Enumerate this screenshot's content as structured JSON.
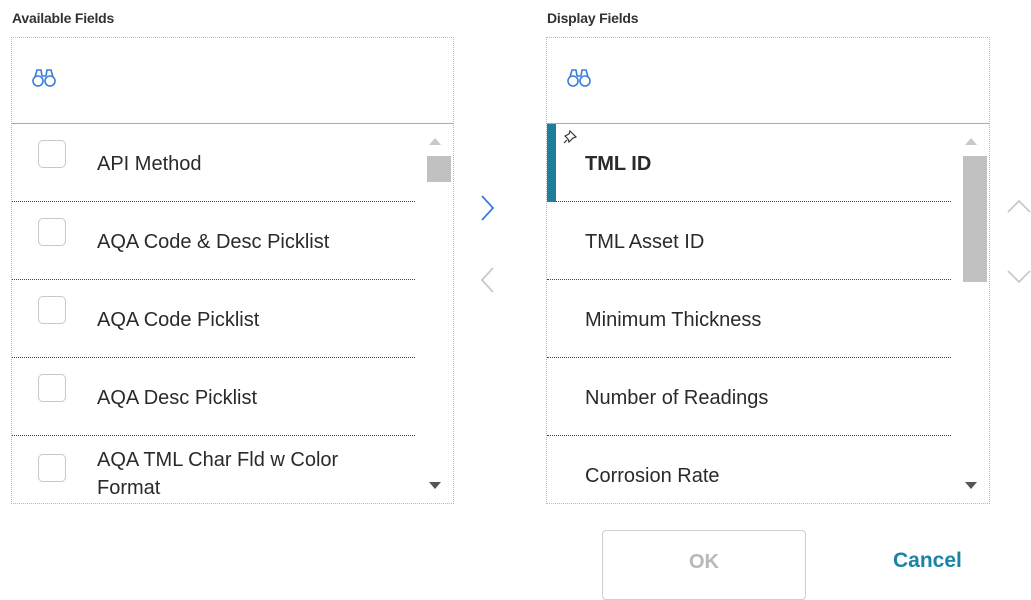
{
  "available": {
    "title": "Available Fields",
    "items": [
      {
        "label": "API Method"
      },
      {
        "label": "AQA Code & Desc Picklist"
      },
      {
        "label": "AQA Code Picklist"
      },
      {
        "label": "AQA Desc Picklist"
      },
      {
        "line1": "AQA TML Char Fld w Color",
        "line2": "Format"
      }
    ]
  },
  "display": {
    "title": "Display Fields",
    "items": [
      {
        "label": "TML ID",
        "selected": true,
        "pinned": true
      },
      {
        "label": "TML Asset ID"
      },
      {
        "label": "Minimum Thickness"
      },
      {
        "label": "Number of Readings"
      },
      {
        "label": "Corrosion Rate"
      }
    ]
  },
  "actions": {
    "ok_label": "OK",
    "cancel_label": "Cancel"
  },
  "colors": {
    "accent": "#1f7e9b",
    "link": "#1a84a5",
    "icon": "#3a7fd5",
    "disabled_text": "#b8b8b8"
  },
  "icons": [
    "binoculars-icon",
    "pin-icon",
    "chevron-right-icon",
    "chevron-left-icon",
    "chevron-up-icon",
    "chevron-down-icon"
  ]
}
